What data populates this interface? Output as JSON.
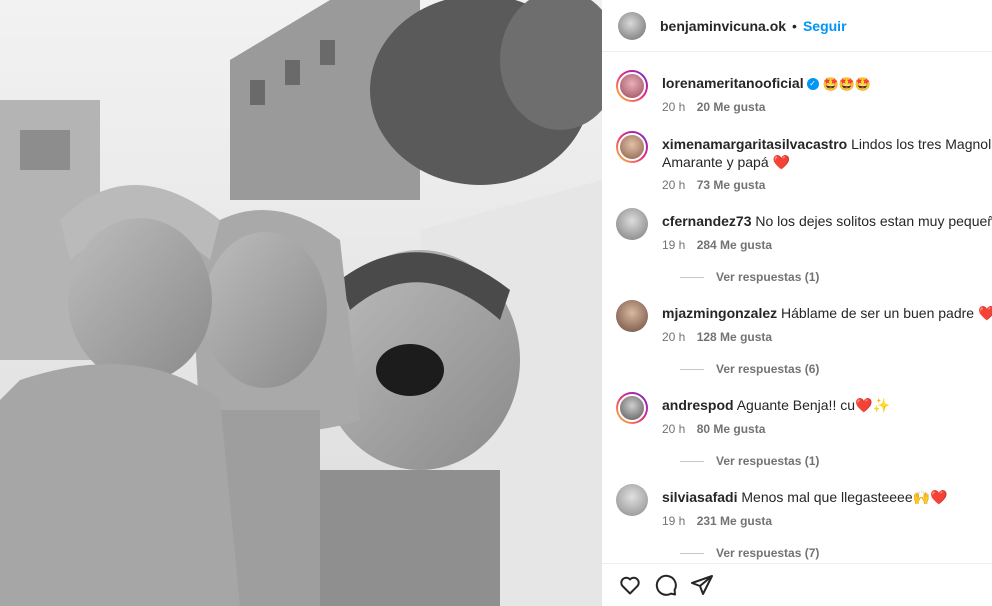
{
  "header": {
    "username": "benjaminvicuna.ok",
    "dot": "•",
    "follow_label": "Seguir"
  },
  "photo": {
    "description_icon": "post-photo"
  },
  "comments": [
    {
      "user": "lorenameritanooficial",
      "verified": true,
      "text": "🤩🤩🤩",
      "time": "20 h",
      "likes": "20 Me gusta",
      "replies": ""
    },
    {
      "user": "ximenamargaritasilvacastro",
      "verified": false,
      "text": "Lindos los tres Magnolia Amarante y papá ❤️",
      "time": "20 h",
      "likes": "73 Me gusta",
      "replies": ""
    },
    {
      "user": "cfernandez73",
      "verified": false,
      "text": "No los dejes solitos estan muy pequeños ❤️",
      "time": "19 h",
      "likes": "284 Me gusta",
      "replies": "Ver respuestas (1)"
    },
    {
      "user": "mjazmingonzalez",
      "verified": false,
      "text": "Háblame de ser un buen padre ❤️🤩",
      "time": "20 h",
      "likes": "128 Me gusta",
      "replies": "Ver respuestas (6)"
    },
    {
      "user": "andrespod",
      "verified": false,
      "text": "Aguante Benja!! cu❤️✨",
      "time": "20 h",
      "likes": "80 Me gusta",
      "replies": "Ver respuestas (1)"
    },
    {
      "user": "silviasafadi",
      "verified": false,
      "text": "Menos mal que llegasteeee🙌❤️",
      "time": "19 h",
      "likes": "231 Me gusta",
      "replies": "Ver respuestas (7)"
    }
  ],
  "actions": {
    "like_icon": "heart-icon",
    "comment_icon": "comment-icon",
    "share_icon": "share-icon"
  }
}
